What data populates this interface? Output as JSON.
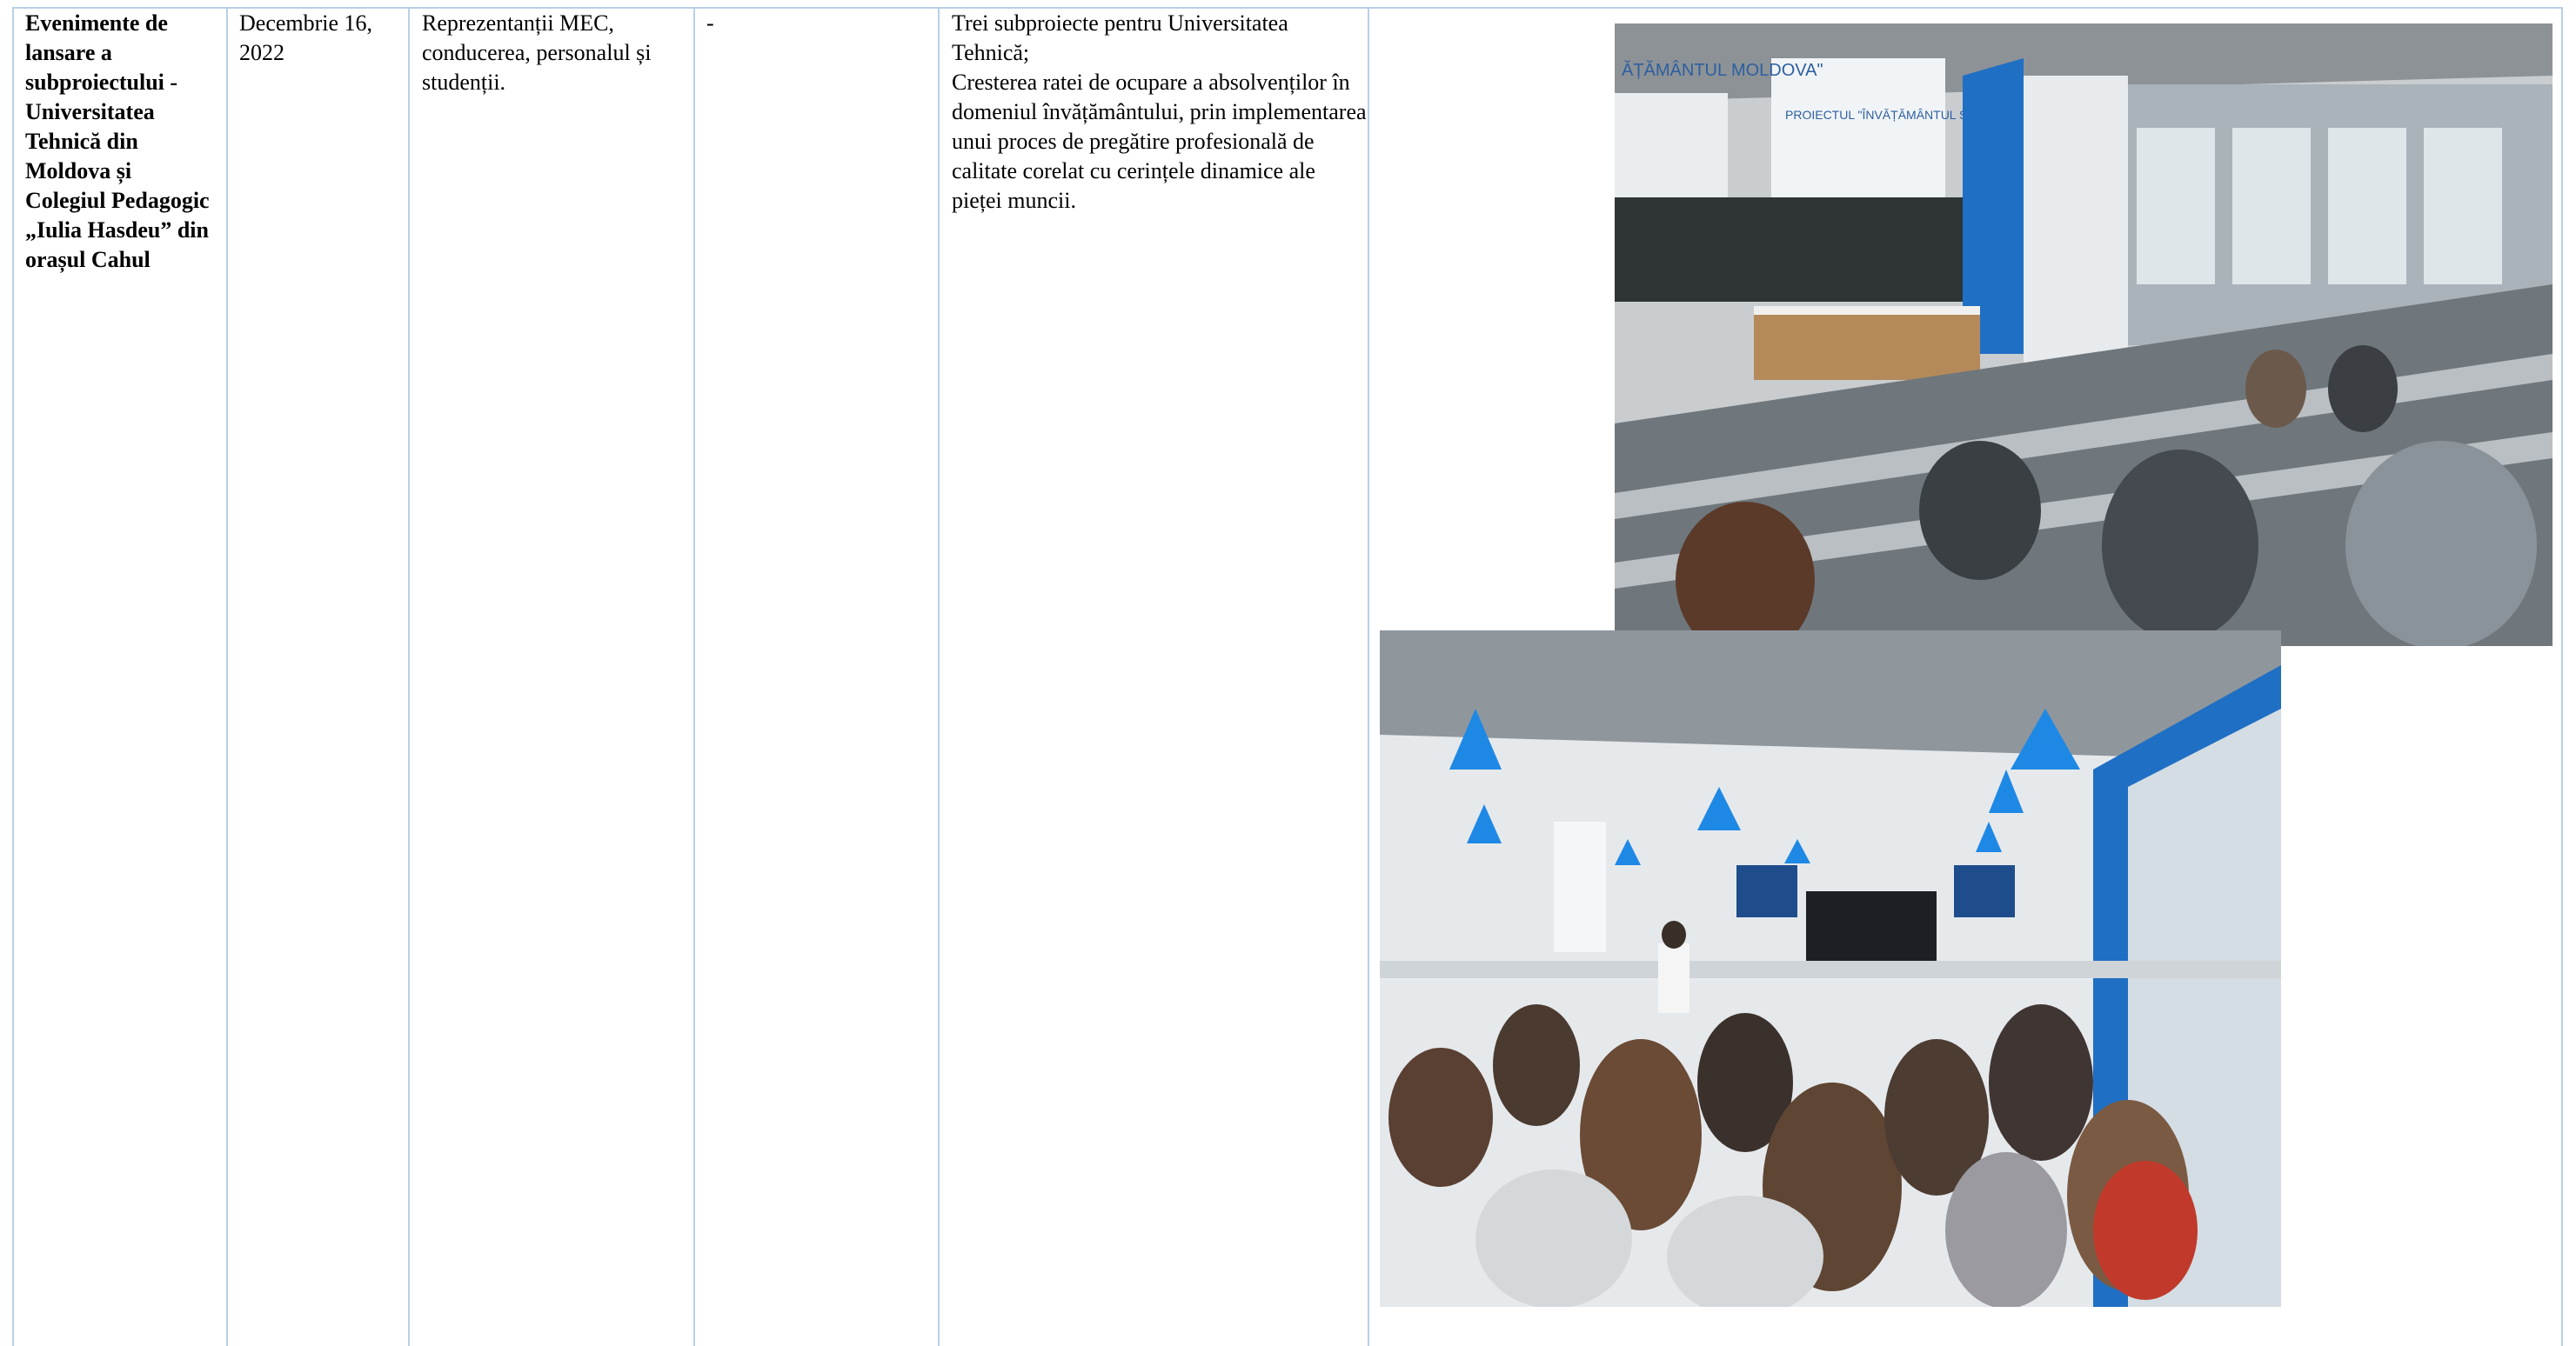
{
  "row": {
    "title": "Evenimente de lansare a subproiectului - Universitatea Tehnică din Moldova și Colegiul Pedagogic „Iulia Hasdeu” din orașul Cahul",
    "date": "Decembrie 16, 2022",
    "participants": "Reprezentanții MEC, conducerea, personalul și studenții.",
    "extra": "-",
    "results_line1": "Trei subproiecte pentru Universitatea Tehnică;",
    "results_line2": "Cresterea ratei de ocupare a absolvenților în domeniul învățământului, prin implementarea unui proces de pregătire profesională de calitate corelat cu cerințele dinamice ale pieței muncii."
  },
  "photos": {
    "auditorium_screen_left": "ĂȚĂMÂNTUL MOLDOVA\"",
    "auditorium_screen_right": "PROIECTUL \"ÎNVĂȚĂMÂNTUL SUPERIOR DIN MOLDOVA\""
  },
  "colors": {
    "border": "#b9d0e6",
    "lamp_blue": "#1e88e5",
    "wall_blue": "#1f6fc4"
  }
}
